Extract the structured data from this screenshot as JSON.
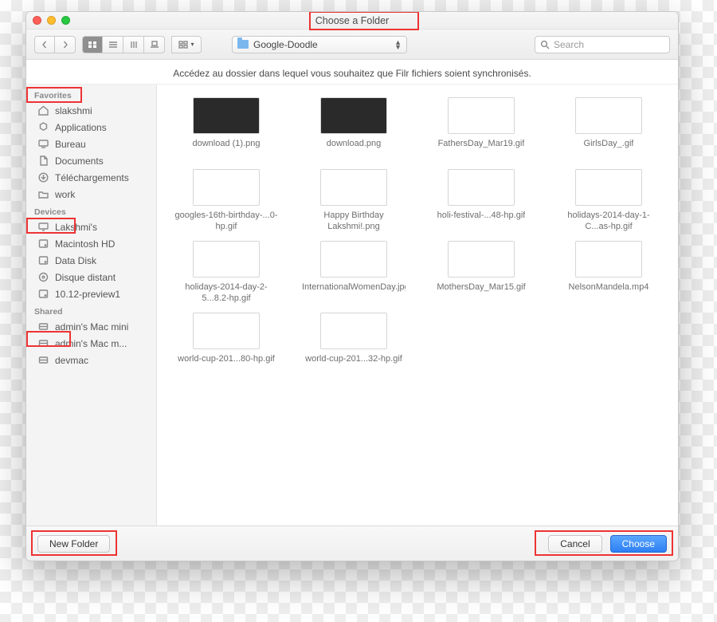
{
  "window": {
    "title": "Choose a Folder"
  },
  "toolbar": {
    "path_label": "Google-Doodle",
    "search_placeholder": "Search"
  },
  "message": "Accédez au dossier dans lequel vous souhaitez que Filr fichiers soient synchronisés.",
  "sidebar": {
    "sections": [
      {
        "title": "Favorites",
        "items": [
          {
            "label": "slakshmi",
            "icon": "home-icon"
          },
          {
            "label": "Applications",
            "icon": "apps-icon"
          },
          {
            "label": "Bureau",
            "icon": "desktop-icon"
          },
          {
            "label": "Documents",
            "icon": "documents-icon"
          },
          {
            "label": "Téléchargements",
            "icon": "downloads-icon"
          },
          {
            "label": "work",
            "icon": "folder-icon"
          }
        ]
      },
      {
        "title": "Devices",
        "items": [
          {
            "label": "Lakshmi's",
            "icon": "computer-icon"
          },
          {
            "label": "Macintosh HD",
            "icon": "disk-icon"
          },
          {
            "label": "Data Disk",
            "icon": "disk-icon"
          },
          {
            "label": "Disque distant",
            "icon": "remote-disc-icon"
          },
          {
            "label": "10.12-preview1",
            "icon": "disk-icon"
          }
        ]
      },
      {
        "title": "Shared",
        "items": [
          {
            "label": "admin's Mac mini",
            "icon": "server-icon"
          },
          {
            "label": "admin's Mac m...",
            "icon": "server-icon"
          },
          {
            "label": "devmac",
            "icon": "server-icon"
          }
        ]
      }
    ]
  },
  "files": [
    {
      "name": "download (1).png",
      "thumb": "dark"
    },
    {
      "name": "download.png",
      "thumb": "dark"
    },
    {
      "name": "FathersDay_Mar19.gif",
      "thumb": "light"
    },
    {
      "name": "GirlsDay_.gif",
      "thumb": "light"
    },
    {
      "name": "googles-16th-birthday-...0-hp.gif",
      "thumb": "light"
    },
    {
      "name": "Happy Birthday Lakshmi!.png",
      "thumb": "light"
    },
    {
      "name": "holi-festival-...48-hp.gif",
      "thumb": "light"
    },
    {
      "name": "holidays-2014-day-1-C...as-hp.gif",
      "thumb": "light"
    },
    {
      "name": "holidays-2014-day-2-5...8.2-hp.gif",
      "thumb": "light"
    },
    {
      "name": "InternationalWomenDay.jpg",
      "thumb": "light"
    },
    {
      "name": "MothersDay_Mar15.gif",
      "thumb": "light"
    },
    {
      "name": "NelsonMandela.mp4",
      "thumb": "light"
    },
    {
      "name": "world-cup-201...80-hp.gif",
      "thumb": "light"
    },
    {
      "name": "world-cup-201...32-hp.gif",
      "thumb": "light"
    }
  ],
  "footer": {
    "new_folder": "New Folder",
    "cancel": "Cancel",
    "choose": "Choose"
  }
}
